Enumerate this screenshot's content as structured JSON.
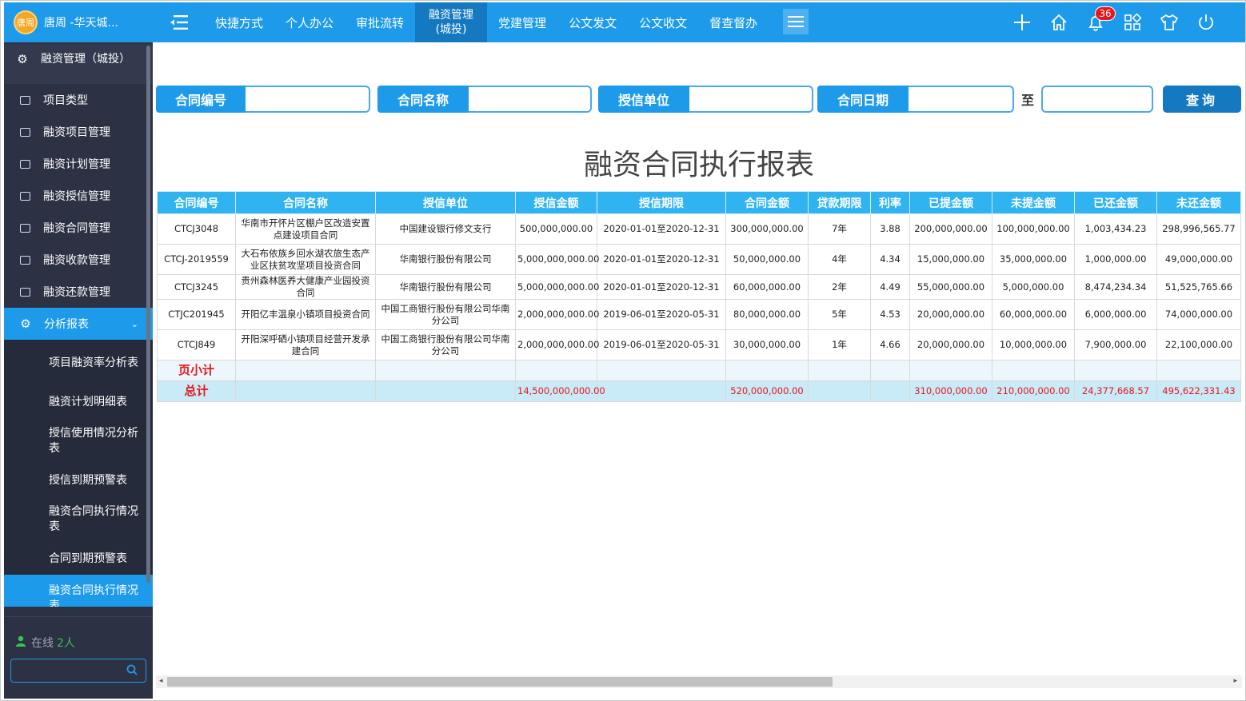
{
  "user": {
    "avatar_text": "唐周",
    "name": "唐周 -华天城..."
  },
  "sidebar": {
    "head": "融资管理（城投）",
    "items": [
      {
        "label": "项目类型",
        "icon": "folder-icon"
      },
      {
        "label": "融资项目管理",
        "icon": "folder-icon"
      },
      {
        "label": "融资计划管理",
        "icon": "folder-icon"
      },
      {
        "label": "融资授信管理",
        "icon": "folder-icon"
      },
      {
        "label": "融资合同管理",
        "icon": "folder-icon"
      },
      {
        "label": "融资收款管理",
        "icon": "folder-icon"
      },
      {
        "label": "融资还款管理",
        "icon": "folder-icon"
      }
    ],
    "active_group": "分析报表",
    "sub_items": [
      "项目融资率分析表",
      "融资计划明细表",
      "授信使用情况分析表",
      "授信到期预警表",
      "融资合同执行情况表",
      "合同到期预警表",
      "融资合同执行情况表"
    ],
    "online_label": "在线",
    "online_count": "2人"
  },
  "topnav": {
    "items": [
      "快捷方式",
      "个人办公",
      "审批流转",
      "融资管理\n(城投)",
      "党建管理",
      "公文发文",
      "公文收文",
      "督查督办"
    ],
    "active_index": 3,
    "notification_count": "36"
  },
  "filters": {
    "contract_no_label": "合同编号",
    "contract_name_label": "合同名称",
    "credit_unit_label": "授信单位",
    "contract_date_label": "合同日期",
    "to_label": "至",
    "query_label": "查询",
    "contract_no_value": "",
    "contract_name_value": "",
    "credit_unit_value": "",
    "date_from_value": "",
    "date_to_value": ""
  },
  "report": {
    "title": "融资合同执行报表",
    "columns": [
      "合同编号",
      "合同名称",
      "授信单位",
      "授信金额",
      "授信期限",
      "合同金额",
      "贷款期限",
      "利率",
      "已提金额",
      "未提金额",
      "已还金额",
      "未还金额"
    ],
    "rows": [
      [
        "CTCJ3048",
        "华南市开怀片区棚户区改造安置点建设项目合同",
        "中国建设银行修文支行",
        "500,000,000.00",
        "2020-01-01至2020-12-31",
        "300,000,000.00",
        "7年",
        "3.88",
        "200,000,000.00",
        "100,000,000.00",
        "1,003,434.23",
        "298,996,565.77"
      ],
      [
        "CTCJ-2019559",
        "大石布依族乡回水湖农旅生态产业区扶贫攻坚项目投资合同",
        "华南银行股份有限公司",
        "5,000,000,000.00",
        "2020-01-01至2020-12-31",
        "50,000,000.00",
        "4年",
        "4.34",
        "15,000,000.00",
        "35,000,000.00",
        "1,000,000.00",
        "49,000,000.00"
      ],
      [
        "CTCJ3245",
        "贵州森林医养大健康产业园投资合同",
        "华南银行股份有限公司",
        "5,000,000,000.00",
        "2020-01-01至2020-12-31",
        "60,000,000.00",
        "2年",
        "4.49",
        "55,000,000.00",
        "5,000,000.00",
        "8,474,234.34",
        "51,525,765.66"
      ],
      [
        "CTJC201945",
        "开阳亿丰温泉小镇项目投资合同",
        "中国工商银行股份有限公司华南分公司",
        "2,000,000,000.00",
        "2019-06-01至2020-05-31",
        "80,000,000.00",
        "5年",
        "4.53",
        "20,000,000.00",
        "60,000,000.00",
        "6,000,000.00",
        "74,000,000.00"
      ],
      [
        "CTCJ849",
        "开阳深呼硒小镇项目经营开发承建合同",
        "中国工商银行股份有限公司华南分公司",
        "2,000,000,000.00",
        "2019-06-01至2020-05-31",
        "30,000,000.00",
        "1年",
        "4.66",
        "20,000,000.00",
        "10,000,000.00",
        "7,900,000.00",
        "22,100,000.00"
      ]
    ],
    "subtotal_label": "页小计",
    "total_label": "总计",
    "totals": {
      "credit_amount": "14,500,000,000.00",
      "contract_amount": "520,000,000.00",
      "drawn": "310,000,000.00",
      "undrawn": "210,000,000.00",
      "repaid": "24,377,668.57",
      "unpaid": "495,622,331.43"
    }
  }
}
